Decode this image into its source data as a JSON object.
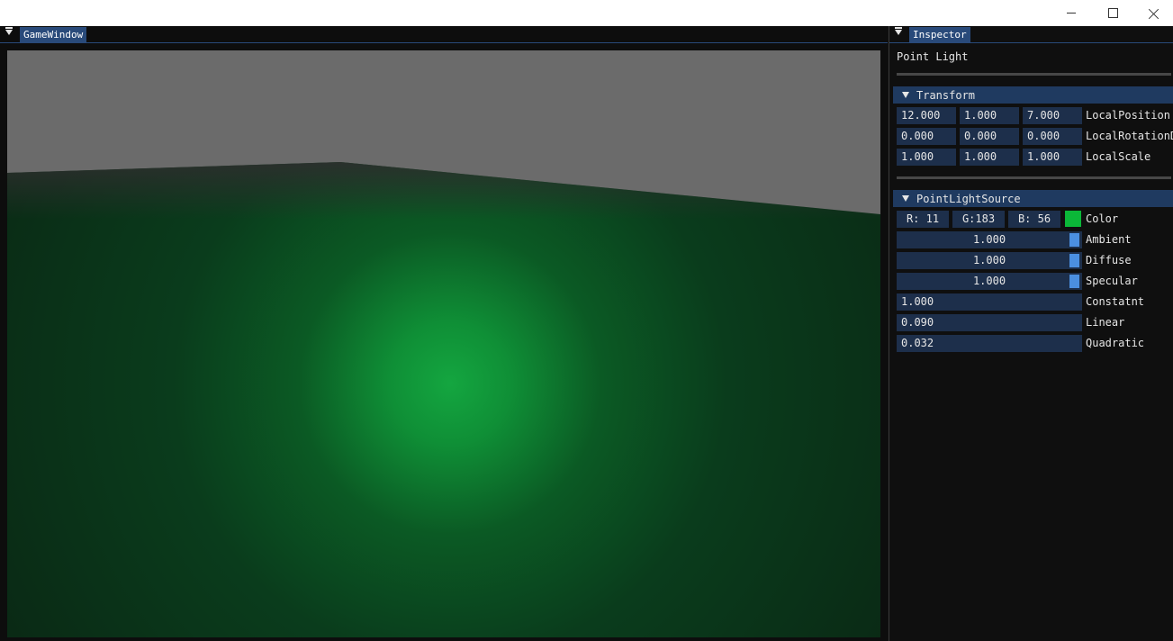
{
  "window": {
    "minimize_icon": "minimize-icon",
    "maximize_icon": "maximize-icon",
    "close_icon": "close-icon"
  },
  "game_window": {
    "title": "GameWindow"
  },
  "inspector": {
    "title": "Inspector",
    "object_name": "Point Light",
    "transform": {
      "header": "Transform",
      "position": {
        "x": "12.000",
        "y": "1.000",
        "z": "7.000",
        "label": "LocalPosition"
      },
      "rotation": {
        "x": "0.000",
        "y": "0.000",
        "z": "0.000",
        "label": "LocalRotationD"
      },
      "scale": {
        "x": "1.000",
        "y": "1.000",
        "z": "1.000",
        "label": "LocalScale"
      }
    },
    "point_light": {
      "header": "PointLightSource",
      "color": {
        "r": "R: 11",
        "g": "G:183",
        "b": "B: 56",
        "label": "Color",
        "swatch": "#0bb738"
      },
      "ambient": {
        "value": "1.000",
        "label": "Ambient"
      },
      "diffuse": {
        "value": "1.000",
        "label": "Diffuse"
      },
      "specular": {
        "value": "1.000",
        "label": "Specular"
      },
      "constant": {
        "value": "1.000",
        "label": "Constatnt"
      },
      "linear": {
        "value": "0.090",
        "label": "Linear"
      },
      "quadratic": {
        "value": "0.032",
        "label": "Quadratic"
      }
    }
  },
  "colors": {
    "accent": "#294a7a",
    "header": "#1f3a60",
    "field": "#1d2f4b",
    "slider": "#4b8fe0"
  }
}
